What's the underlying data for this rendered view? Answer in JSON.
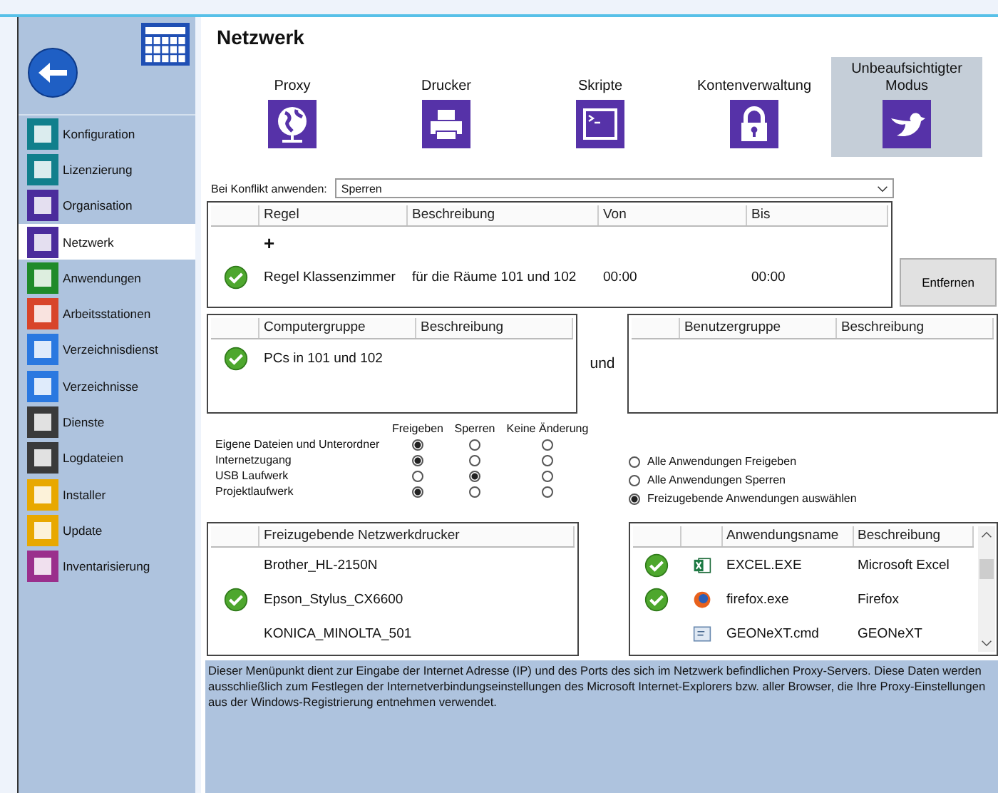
{
  "sidebar": {
    "items": [
      {
        "label": "Konfiguration",
        "selected": false,
        "color": "#117f8c"
      },
      {
        "label": "Lizenzierung",
        "selected": false,
        "color": "#117f8c"
      },
      {
        "label": "Organisation",
        "selected": false,
        "color": "#4b2c9c"
      },
      {
        "label": "Netzwerk",
        "selected": true,
        "color": "#4b2c9c"
      },
      {
        "label": "Anwendungen",
        "selected": false,
        "color": "#1f8a2a"
      },
      {
        "label": "Arbeitsstationen",
        "selected": false,
        "color": "#d8452a"
      },
      {
        "label": "Verzeichnisdienst",
        "selected": false,
        "color": "#2a78e0"
      },
      {
        "label": "Verzeichnisse",
        "selected": false,
        "color": "#2a78e0"
      },
      {
        "label": "Dienste",
        "selected": false,
        "color": "#3a3a3a"
      },
      {
        "label": "Logdateien",
        "selected": false,
        "color": "#3a3a3a"
      },
      {
        "label": "Installer",
        "selected": false,
        "color": "#e8a800"
      },
      {
        "label": "Update",
        "selected": false,
        "color": "#e8a800"
      },
      {
        "label": "Inventarisierung",
        "selected": false,
        "color": "#9a2f8c"
      }
    ]
  },
  "title": "Netzwerk",
  "tools": [
    {
      "label": "Proxy",
      "selected": false
    },
    {
      "label": "Drucker",
      "selected": false
    },
    {
      "label": "Skripte",
      "selected": false
    },
    {
      "label": "Kontenverwaltung",
      "selected": false
    },
    {
      "label": "Unbeaufsichtigter Modus",
      "selected": true
    }
  ],
  "conflict": {
    "label": "Bei Konflikt anwenden:",
    "value": "Sperren"
  },
  "rules": {
    "columns": [
      "Regel",
      "Beschreibung",
      "Von",
      "Bis"
    ],
    "add": "+",
    "rows": [
      {
        "active": true,
        "rule": "Regel Klassenzimmer",
        "description": "für die Räume 101 und 102",
        "from": "00:00",
        "to": "00:00"
      }
    ]
  },
  "remove_button": "Entfernen",
  "computer_groups": {
    "columns": [
      "Computergruppe",
      "Beschreibung"
    ],
    "rows": [
      {
        "active": true,
        "name": "PCs in 101 und 102",
        "description": ""
      }
    ]
  },
  "conjunction": "und",
  "user_groups": {
    "columns": [
      "Benutzergruppe",
      "Beschreibung"
    ]
  },
  "permissions": {
    "columns": [
      "Freigeben",
      "Sperren",
      "Keine Änderung"
    ],
    "rows": [
      {
        "label": "Eigene Dateien und Unterordner",
        "options": [
          {
            "selected": true
          },
          {
            "selected": false
          },
          {
            "selected": false
          }
        ]
      },
      {
        "label": "Internetzugang",
        "options": [
          {
            "selected": true
          },
          {
            "selected": false
          },
          {
            "selected": false
          }
        ]
      },
      {
        "label": "USB Laufwerk",
        "options": [
          {
            "selected": false
          },
          {
            "selected": true
          },
          {
            "selected": false
          }
        ]
      },
      {
        "label": "Projektlaufwerk",
        "options": [
          {
            "selected": true
          },
          {
            "selected": false
          },
          {
            "selected": false
          }
        ]
      }
    ]
  },
  "app_mode": [
    {
      "label": "Alle Anwendungen Freigeben",
      "selected": false
    },
    {
      "label": "Alle Anwendungen Sperren",
      "selected": false
    },
    {
      "label": "Freizugebende Anwendungen auswählen",
      "selected": true
    }
  ],
  "printers": {
    "column": "Freizugebende Netzwerkdrucker",
    "rows": [
      {
        "name": "Brother_HL-2150N",
        "active": false
      },
      {
        "name": "Epson_Stylus_CX6600",
        "active": true
      },
      {
        "name": "KONICA_MINOLTA_501",
        "active": false
      }
    ]
  },
  "apps": {
    "columns": [
      "Anwendungsname",
      "Beschreibung"
    ],
    "rows": [
      {
        "active": true,
        "name": "EXCEL.EXE",
        "description": "Microsoft Excel"
      },
      {
        "active": true,
        "name": "firefox.exe",
        "description": "Firefox"
      },
      {
        "active": false,
        "name": "GEONeXT.cmd",
        "description": "GEONeXT"
      }
    ]
  },
  "help_text": "Dieser Menüpunkt dient zur Eingabe der Internet Adresse (IP) und des Ports des sich im Netzwerk befindlichen Proxy-Servers. Diese Daten werden ausschließlich zum Festlegen der Internetverbindungseinstellungen des Microsoft Internet-Explorers bzw. aller Browser, die Ihre Proxy-Einstellungen aus der Windows-Registrierung entnehmen verwendet."
}
